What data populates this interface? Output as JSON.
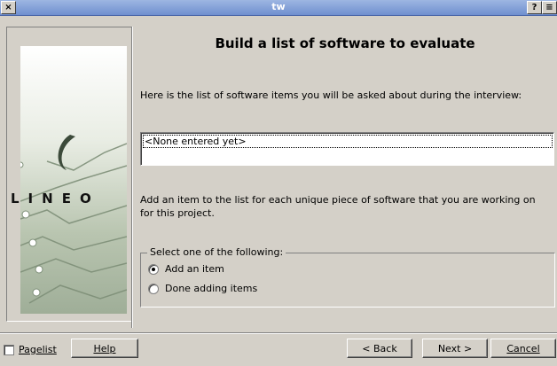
{
  "window": {
    "title": "tw",
    "close_glyph": "×",
    "help_glyph": "?",
    "menu_glyph": "≡"
  },
  "sidebar": {
    "logo_text": "LINEO"
  },
  "main": {
    "title": "Build a list of software to evaluate",
    "intro": "Here is the list of software items you will be asked about during the interview:",
    "list_items": [
      "<None entered yet>"
    ],
    "instructions": "Add an item to the list for each unique piece of software that you are working on for this project.",
    "group_label": "Select one of the following:",
    "options": [
      {
        "label": "Add an item",
        "selected": true
      },
      {
        "label": "Done adding items",
        "selected": false
      }
    ]
  },
  "footer": {
    "pagelist_label": "Pagelist",
    "help_label": "Help",
    "back_label": "< Back",
    "next_label": "Next >",
    "cancel_label": "Cancel"
  },
  "colors": {
    "dialog_bg": "#d4d0c8",
    "titlebar": "#7f9dd8"
  }
}
